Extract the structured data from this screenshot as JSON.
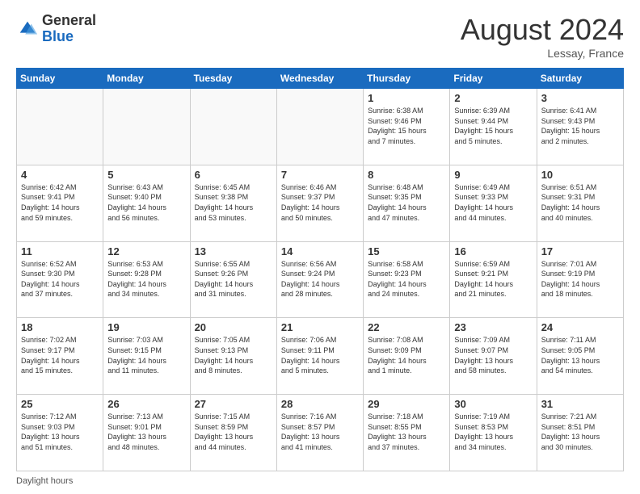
{
  "logo": {
    "general": "General",
    "blue": "Blue"
  },
  "title": "August 2024",
  "location": "Lessay, France",
  "weekdays": [
    "Sunday",
    "Monday",
    "Tuesday",
    "Wednesday",
    "Thursday",
    "Friday",
    "Saturday"
  ],
  "footer": "Daylight hours",
  "weeks": [
    [
      {
        "num": "",
        "info": ""
      },
      {
        "num": "",
        "info": ""
      },
      {
        "num": "",
        "info": ""
      },
      {
        "num": "",
        "info": ""
      },
      {
        "num": "1",
        "info": "Sunrise: 6:38 AM\nSunset: 9:46 PM\nDaylight: 15 hours\nand 7 minutes."
      },
      {
        "num": "2",
        "info": "Sunrise: 6:39 AM\nSunset: 9:44 PM\nDaylight: 15 hours\nand 5 minutes."
      },
      {
        "num": "3",
        "info": "Sunrise: 6:41 AM\nSunset: 9:43 PM\nDaylight: 15 hours\nand 2 minutes."
      }
    ],
    [
      {
        "num": "4",
        "info": "Sunrise: 6:42 AM\nSunset: 9:41 PM\nDaylight: 14 hours\nand 59 minutes."
      },
      {
        "num": "5",
        "info": "Sunrise: 6:43 AM\nSunset: 9:40 PM\nDaylight: 14 hours\nand 56 minutes."
      },
      {
        "num": "6",
        "info": "Sunrise: 6:45 AM\nSunset: 9:38 PM\nDaylight: 14 hours\nand 53 minutes."
      },
      {
        "num": "7",
        "info": "Sunrise: 6:46 AM\nSunset: 9:37 PM\nDaylight: 14 hours\nand 50 minutes."
      },
      {
        "num": "8",
        "info": "Sunrise: 6:48 AM\nSunset: 9:35 PM\nDaylight: 14 hours\nand 47 minutes."
      },
      {
        "num": "9",
        "info": "Sunrise: 6:49 AM\nSunset: 9:33 PM\nDaylight: 14 hours\nand 44 minutes."
      },
      {
        "num": "10",
        "info": "Sunrise: 6:51 AM\nSunset: 9:31 PM\nDaylight: 14 hours\nand 40 minutes."
      }
    ],
    [
      {
        "num": "11",
        "info": "Sunrise: 6:52 AM\nSunset: 9:30 PM\nDaylight: 14 hours\nand 37 minutes."
      },
      {
        "num": "12",
        "info": "Sunrise: 6:53 AM\nSunset: 9:28 PM\nDaylight: 14 hours\nand 34 minutes."
      },
      {
        "num": "13",
        "info": "Sunrise: 6:55 AM\nSunset: 9:26 PM\nDaylight: 14 hours\nand 31 minutes."
      },
      {
        "num": "14",
        "info": "Sunrise: 6:56 AM\nSunset: 9:24 PM\nDaylight: 14 hours\nand 28 minutes."
      },
      {
        "num": "15",
        "info": "Sunrise: 6:58 AM\nSunset: 9:23 PM\nDaylight: 14 hours\nand 24 minutes."
      },
      {
        "num": "16",
        "info": "Sunrise: 6:59 AM\nSunset: 9:21 PM\nDaylight: 14 hours\nand 21 minutes."
      },
      {
        "num": "17",
        "info": "Sunrise: 7:01 AM\nSunset: 9:19 PM\nDaylight: 14 hours\nand 18 minutes."
      }
    ],
    [
      {
        "num": "18",
        "info": "Sunrise: 7:02 AM\nSunset: 9:17 PM\nDaylight: 14 hours\nand 15 minutes."
      },
      {
        "num": "19",
        "info": "Sunrise: 7:03 AM\nSunset: 9:15 PM\nDaylight: 14 hours\nand 11 minutes."
      },
      {
        "num": "20",
        "info": "Sunrise: 7:05 AM\nSunset: 9:13 PM\nDaylight: 14 hours\nand 8 minutes."
      },
      {
        "num": "21",
        "info": "Sunrise: 7:06 AM\nSunset: 9:11 PM\nDaylight: 14 hours\nand 5 minutes."
      },
      {
        "num": "22",
        "info": "Sunrise: 7:08 AM\nSunset: 9:09 PM\nDaylight: 14 hours\nand 1 minute."
      },
      {
        "num": "23",
        "info": "Sunrise: 7:09 AM\nSunset: 9:07 PM\nDaylight: 13 hours\nand 58 minutes."
      },
      {
        "num": "24",
        "info": "Sunrise: 7:11 AM\nSunset: 9:05 PM\nDaylight: 13 hours\nand 54 minutes."
      }
    ],
    [
      {
        "num": "25",
        "info": "Sunrise: 7:12 AM\nSunset: 9:03 PM\nDaylight: 13 hours\nand 51 minutes."
      },
      {
        "num": "26",
        "info": "Sunrise: 7:13 AM\nSunset: 9:01 PM\nDaylight: 13 hours\nand 48 minutes."
      },
      {
        "num": "27",
        "info": "Sunrise: 7:15 AM\nSunset: 8:59 PM\nDaylight: 13 hours\nand 44 minutes."
      },
      {
        "num": "28",
        "info": "Sunrise: 7:16 AM\nSunset: 8:57 PM\nDaylight: 13 hours\nand 41 minutes."
      },
      {
        "num": "29",
        "info": "Sunrise: 7:18 AM\nSunset: 8:55 PM\nDaylight: 13 hours\nand 37 minutes."
      },
      {
        "num": "30",
        "info": "Sunrise: 7:19 AM\nSunset: 8:53 PM\nDaylight: 13 hours\nand 34 minutes."
      },
      {
        "num": "31",
        "info": "Sunrise: 7:21 AM\nSunset: 8:51 PM\nDaylight: 13 hours\nand 30 minutes."
      }
    ]
  ]
}
